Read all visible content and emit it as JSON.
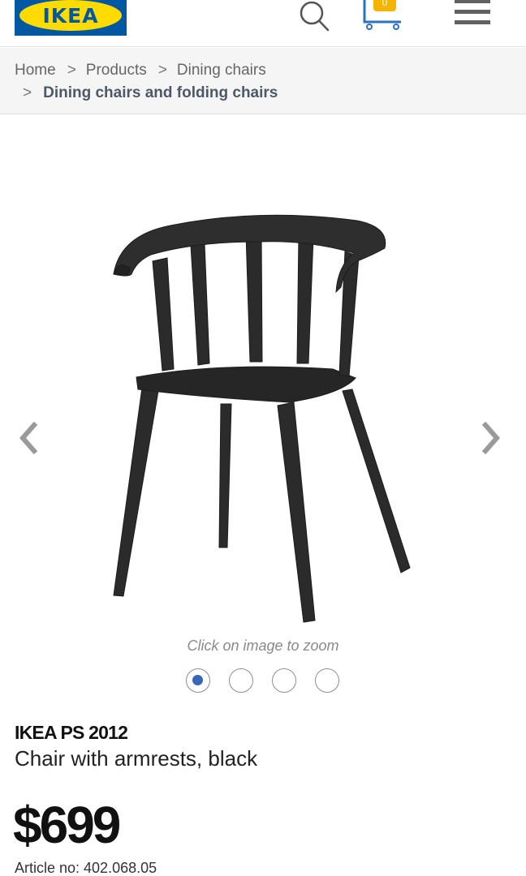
{
  "header": {
    "logo_text": "IKEA",
    "search_icon": "search-icon",
    "cart_icon": "cart-icon",
    "cart_count": "0",
    "menu_icon": "hamburger-menu-icon",
    "colors": {
      "brand_blue": "#0058a3",
      "brand_yellow": "#ffdb00",
      "badge": "#f5b400"
    }
  },
  "breadcrumb": {
    "separator": ">",
    "items": [
      "Home",
      "Products",
      "Dining chairs",
      "Dining chairs and folding chairs"
    ]
  },
  "gallery": {
    "zoom_hint": "Click on image to zoom",
    "prev_icon": "chevron-left-icon",
    "next_icon": "chevron-right-icon",
    "image_count": 4,
    "active_index": 0,
    "active_dot_color": "#3867b8"
  },
  "product": {
    "name": "IKEA PS 2012",
    "description": "Chair with armrests, black",
    "price": "$699",
    "article": "Article no: 402.068.05"
  }
}
